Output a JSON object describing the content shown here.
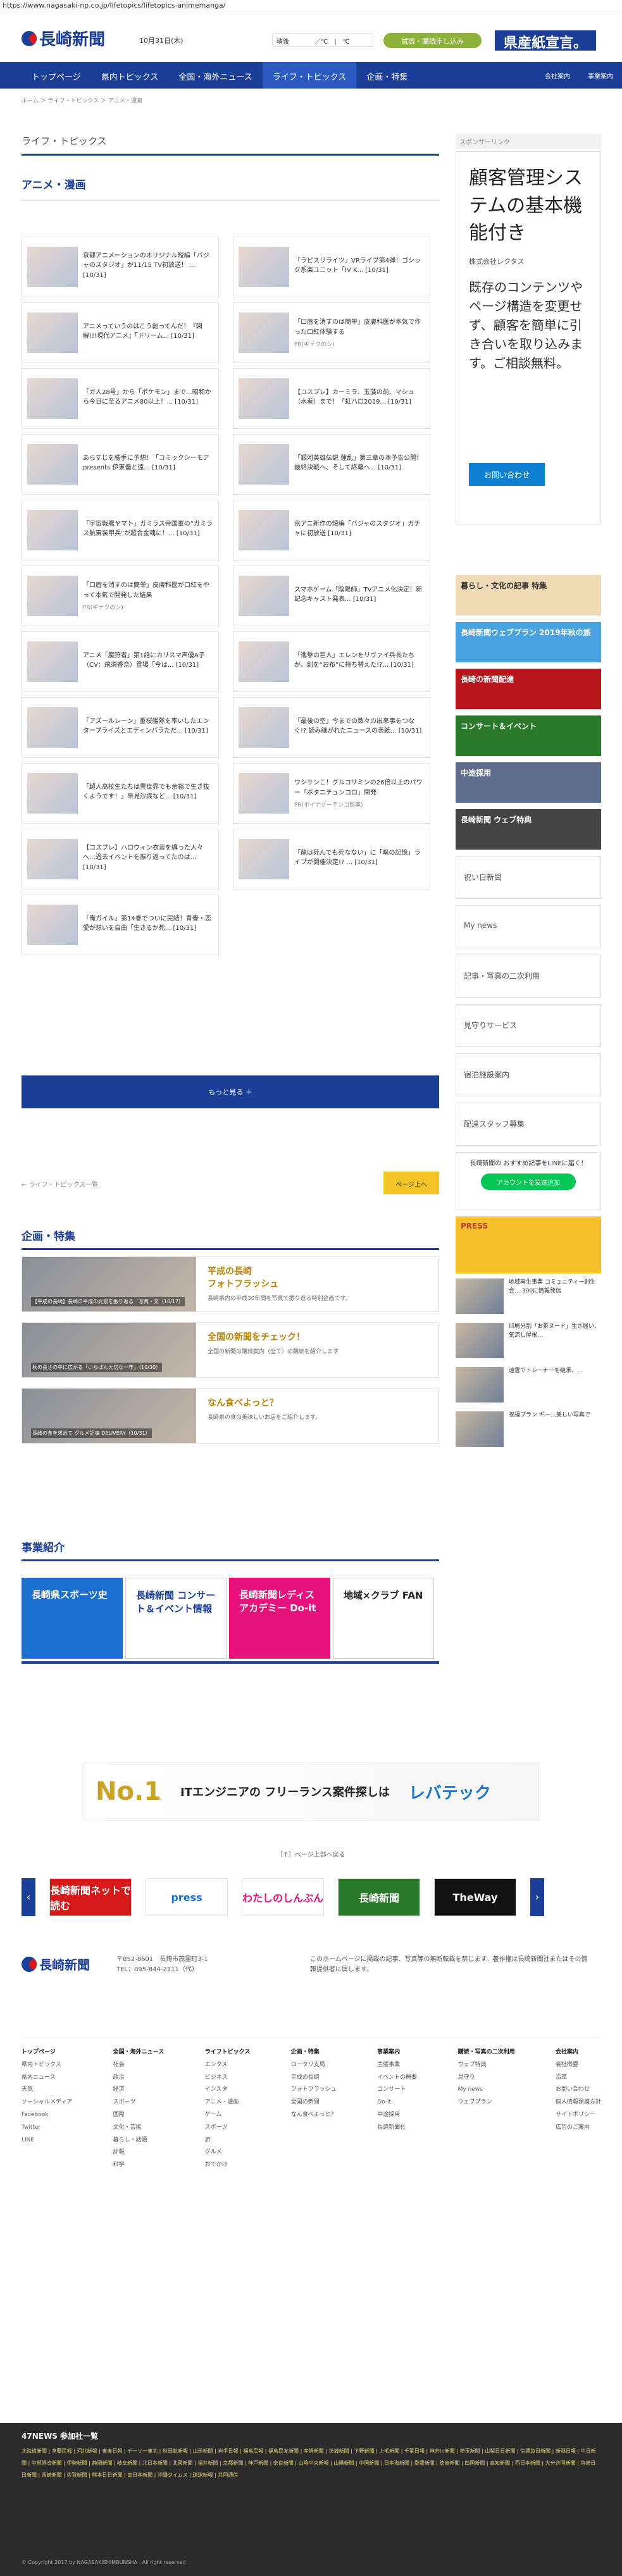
{
  "url": "https://www.nagasaki-np.co.jp/lifetopics/lifetopics-animemanga/",
  "header": {
    "logo": "長崎新聞",
    "date": "10月31日(木)",
    "weather": "晴後　　　　／℃　|　℃",
    "trial": "試読・購読申し込み",
    "kenji": "県産紙宣言。"
  },
  "nav": {
    "items": [
      "トップページ",
      "県内トピックス",
      "全国・海外ニュース",
      "ライフ・トピックス",
      "企画・特集"
    ],
    "right": [
      "会社案内",
      "事業案内"
    ]
  },
  "breadcrumb": "ホーム ＞ ライフ・トピックス ＞ アニメ・漫画",
  "section_title": "ライフ・トピックス",
  "category_title": "アニメ・漫画",
  "articles": [
    {
      "text": "京都アニメーションのオリジナル短編「バジャのスタジオ」が11/15 TV初放送！ ... [10/31]",
      "pr": ""
    },
    {
      "text": "「ラピスリライツ」VRライブ第4弾！ゴシック系楽ユニット「IV K... [10/31]",
      "pr": ""
    },
    {
      "text": "アニメっていうのはこう創ってんだ！『図解!!!現代アニメ』「ドリーム... [10/31]",
      "pr": ""
    },
    {
      "text": "「口唇を消すのは簡単」皮膚科医が本気で作った口紅体験する",
      "pr": "PR(ギテクのシ)"
    },
    {
      "text": "「ガ人28号」から「ポケモン」まで…昭和から今日に至るアニメ80以上！... [10/31]",
      "pr": ""
    },
    {
      "text": "【コスプレ】カーミラ、玉藻の前、マシュ（水着）まで！「虹ハロ2019... [10/31]",
      "pr": ""
    },
    {
      "text": "あらすじを勝手に予想！「コミックシーモアpresents 伊東優と遠... [10/31]",
      "pr": ""
    },
    {
      "text": "「銀河英雄伝説 蓮乱」第三章の本予告公開！ 最終決戦へ、そして終幕へ... [10/31]",
      "pr": ""
    },
    {
      "text": "「宇宙戦艦ヤマト」ガミラス帝国軍の“ガミラス航宙装甲兵”が超合金魂に！... [10/31]",
      "pr": ""
    },
    {
      "text": "京アニ新作の短編「バジャのスタジオ」ガチャに初放送 [10/31]",
      "pr": ""
    },
    {
      "text": "「口唇を消すのは簡単」皮膚科医が口紅をやって本気で開発した結果",
      "pr": "PR(ギテクのシ)"
    },
    {
      "text": "スマホゲーム「陰陽師」TVアニメ化決定！新記念キャスト発表... [10/31]",
      "pr": ""
    },
    {
      "text": "アニメ「魔狩者」第1話にカリスマ声優A子（CV：飛須香奈）登場「今は... [10/31]",
      "pr": ""
    },
    {
      "text": "「進撃の巨人」エレンをリヴァイ兵長たちが、剣を“お布”に持ち替えた!?... [10/31]",
      "pr": ""
    },
    {
      "text": "「アズールレーン」重桜艦隊を率いしたエンタープライズとエディンバラただ... [10/31]",
      "pr": ""
    },
    {
      "text": "「最後の空」今までの数々の出来事をつなぐ!? 読み継がれたニュースの表紙... [10/31]",
      "pr": ""
    },
    {
      "text": "「超人高校生たちは異世界でも余裕で生き抜くようです！」早見沙織など... [10/31]",
      "pr": ""
    },
    {
      "text": "ワシサンこ！グルコサミンの26倍以上のパワー「ボタニチュンコロ」開発",
      "pr": "PR(ボイナグーテンコ製薬)"
    },
    {
      "text": "【コスプレ】ハロウィン衣装を纏った人々へ…過去イベントを振り返ってたのは... [10/31]",
      "pr": ""
    },
    {
      "text": "「龍は死んでも死なない」に「暗の記憶」ライブが開催決定!? ... [10/31]",
      "pr": ""
    },
    {
      "text": "「俺ガイル」第14巻でついに完結！青春・恋愛が想いを自由「生きるか死... [10/31]",
      "pr": ""
    }
  ],
  "more_label": "もっと見る ＋",
  "pager": {
    "prev": "← ライフ・トピックス一覧",
    "next": "ページ上へ"
  },
  "features": {
    "title": "企画・特集",
    "items": [
      {
        "h": "平成の長崎\nフォトフラッシュ",
        "d": "長崎県内の平成30年間を写真で振り返る特別企画です。",
        "cap": "【平成の長崎】長崎の平成の光景を振り返る　写真・文（10/17）"
      },
      {
        "h": "全国の新聞をチェック！",
        "d": "全国の新聞の購読案内（全て）の購読を紹介します",
        "cap": "秋の長さの中に広がる「いちばん大切な一年」（10/30）"
      },
      {
        "h": "なん食べよっと？",
        "d": "長崎県の食の美味しいお店をご紹介します。",
        "cap": "長崎の食を求めて グルメ記事 DELIVERY（10/31）"
      }
    ]
  },
  "business": {
    "title": "事業紹介",
    "items": [
      "長崎県スポーツ史",
      "長崎新聞 コンサート＆イベント情報",
      "長崎新聞レディスアカデミー Do-it",
      "地域×クラブ FAN"
    ]
  },
  "sidebar": {
    "sponsor": "スポンサーリンク",
    "ad": {
      "big": "顧客管理システムの基本機能付き",
      "cmp": "株式会社レクタス",
      "sub": "既存のコンテンツやページ構造を変更せず、顧客を簡単に引き合いを取り込みます。ご相談無料。",
      "btn": "お問い合わせ"
    },
    "banners": [
      "暮らし・文化の記事 特集",
      "長崎新聞ウェブプラン 2019年秋の旅",
      "長崎の新聞配達",
      "コンサート＆イベント",
      "中途採用",
      "長崎新聞 ウェブ特典",
      "PRESS"
    ],
    "boxes": [
      "祝い日新聞",
      "My news",
      "記事・写真の二次利用",
      "見守りサービス",
      "宿泊施設案内",
      "配達スタッフ募集"
    ],
    "line": {
      "t": "長崎新聞の おすすめ記事をLINEに届く！",
      "b": "アカウントを友達追加"
    },
    "news": [
      "地域再生事業 コミュニティー創生会… 300に情報発信",
      "印刷分割「お茶ヌード」生き届い、 気流し屋根...",
      "遠雲でトレーナーを継承、...",
      "祝福プラン ギー…美しい写真で"
    ]
  },
  "footer_ad": {
    "n1": "No.1",
    "it": "ITエンジニアの フリーランス案件探しは",
    "lv": "レバテック"
  },
  "jump": "［↑］ページ上部へ戻る",
  "carousel": [
    "長崎新聞ネットで読む",
    "press",
    "わたしのしんぶん",
    "長崎新聞",
    "TheWay"
  ],
  "footer": {
    "a": "〒852-8601　長崎市茂里町3-1\nTEL：095-844-2111（代）",
    "b": "このホームページに掲載の記事、写真等の無断転載を禁じます。著作権は長崎新聞社またはその情報提供者に属します。"
  },
  "footer_nav": [
    [
      "トップページ",
      "県内トピックス",
      "県内ニュース",
      "天気",
      "ソーシャルメディア",
      "Facebook",
      "Twitter",
      "LINE"
    ],
    [
      "全国・海外ニュース",
      "社会",
      "政治",
      "経済",
      "スポーツ",
      "国際",
      "文化・芸能",
      "暮らし・話題",
      "訃報",
      "科学"
    ],
    [
      "ライフトピックス",
      "エンタメ",
      "ビジネス",
      "インスタ",
      "アニメ・漫画",
      "ゲーム",
      "スポーツ",
      "旅",
      "グルメ",
      "おでかけ"
    ],
    [
      "企画・特集",
      "ロータリ支局",
      "平成の長崎",
      "フォトフラッシュ",
      "全国の新聞",
      "なん食べよっと？"
    ],
    [
      "事業案内",
      "主催事業",
      "イベントの概要",
      "コンサート",
      "Do-it",
      "中途採用",
      "長崎新聞社"
    ],
    [
      "購読・写真の二次利用",
      "ウェブ特典",
      "見守り",
      "My news",
      "ウェブプラン"
    ],
    [
      "会社案内",
      "会社概要",
      "沿革",
      "お問い合わせ",
      "個人情報保護方針",
      "サイトポリシー",
      "広告のご案内"
    ]
  ],
  "n47": {
    "h": "47NEWS 参加社一覧",
    "l": "北海道新聞 | 室蘭民報 | 河北新報 | 東奥日報 | デーリー東北 | 秋田魁新報 | 山形新聞 | 岩手日報 | 福島民報 | 福島民友新聞 | 産経新聞 | 茨城新聞 | 下野新聞 | 上毛新聞 | 千葉日報 | 神奈川新聞 | 埼玉新聞 | 山梨日日新聞 | 信濃毎日新聞 | 新潟日報 | 中日新聞 | 中部経済新聞 | 伊勢新聞 | 静岡新聞 | 岐阜新聞 | 北日本新聞 | 北國新聞 | 福井新聞 | 京都新聞 | 神戸新聞 | 奈良新聞 | 山陰中央新報 | 山陽新聞 | 中国新聞 | 日本海新聞 | 愛媛新聞 | 徳島新聞 | 四国新聞 | 高知新聞 | 西日本新聞 | 大分合同新聞 | 宮崎日日新聞 | 長崎新聞 | 佐賀新聞 | 熊本日日新聞 | 南日本新聞 | 沖縄タイムス | 琉球新報 | 共同通信"
  },
  "copyright": "© Copyright 2017 by NAGASAKISHIMBUNSHA . All right reserved"
}
